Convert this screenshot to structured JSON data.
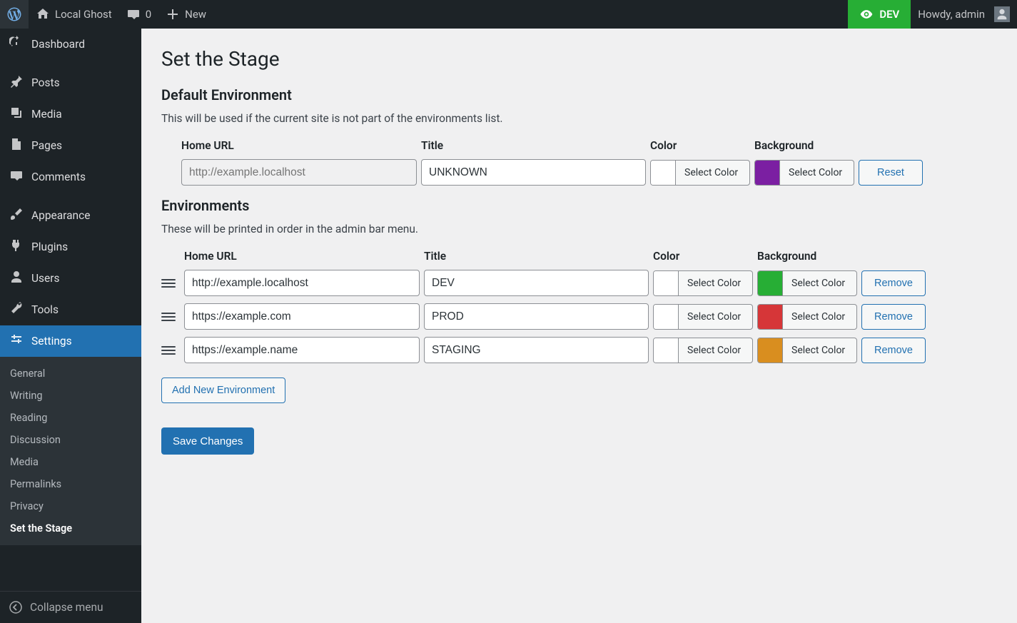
{
  "adminbar": {
    "site_name": "Local Ghost",
    "comments_count": "0",
    "new_label": "New",
    "env_badge": "DEV",
    "howdy_prefix": "Howdy, ",
    "howdy_user": "admin"
  },
  "sidebar": {
    "items": [
      {
        "label": "Dashboard"
      },
      {
        "label": "Posts"
      },
      {
        "label": "Media"
      },
      {
        "label": "Pages"
      },
      {
        "label": "Comments"
      },
      {
        "label": "Appearance"
      },
      {
        "label": "Plugins"
      },
      {
        "label": "Users"
      },
      {
        "label": "Tools"
      },
      {
        "label": "Settings"
      }
    ],
    "submenu": [
      {
        "label": "General"
      },
      {
        "label": "Writing"
      },
      {
        "label": "Reading"
      },
      {
        "label": "Discussion"
      },
      {
        "label": "Media"
      },
      {
        "label": "Permalinks"
      },
      {
        "label": "Privacy"
      },
      {
        "label": "Set the Stage"
      }
    ],
    "collapse_label": "Collapse menu"
  },
  "page": {
    "title": "Set the Stage",
    "section1_title": "Default Environment",
    "section1_desc": "This will be used if the current site is not part of the environments list.",
    "section2_title": "Environments",
    "section2_desc": "These will be printed in order in the admin bar menu.",
    "col_home_url": "Home URL",
    "col_title": "Title",
    "col_color": "Color",
    "col_background": "Background",
    "select_color_label": "Select Color",
    "reset_label": "Reset",
    "remove_label": "Remove",
    "add_env_label": "Add New Environment",
    "save_label": "Save Changes",
    "default_env": {
      "url_placeholder": "http://example.localhost",
      "title": "UNKNOWN",
      "color": "#ffffff",
      "bg": "#7b1fa2"
    },
    "envs": [
      {
        "url": "http://example.localhost",
        "title": "DEV",
        "color": "#ffffff",
        "bg": "#27ae35"
      },
      {
        "url": "https://example.com",
        "title": "PROD",
        "color": "#ffffff",
        "bg": "#d63638"
      },
      {
        "url": "https://example.name",
        "title": "STAGING",
        "color": "#ffffff",
        "bg": "#d98e1f"
      }
    ]
  }
}
